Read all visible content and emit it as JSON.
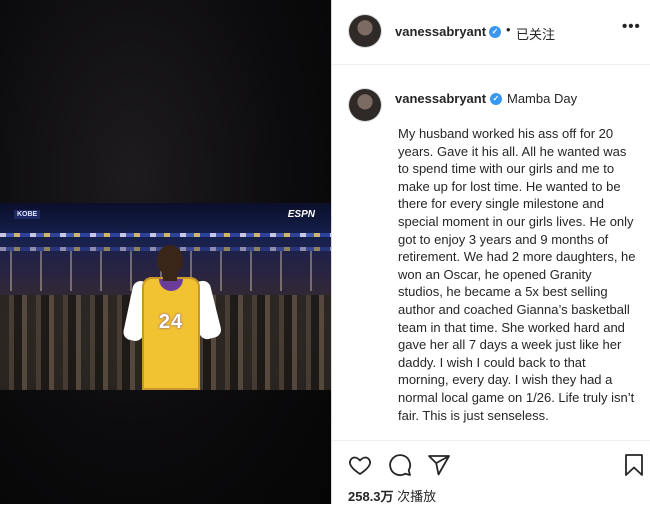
{
  "post": {
    "username": "vanessabryant",
    "verified_icon": "verified-badge-icon",
    "separator": "•",
    "follow_status": "已关注",
    "more_icon": "more-options-icon"
  },
  "video": {
    "overlay_left": "KOBE",
    "overlay_right": "ESPN",
    "jersey_number": "24"
  },
  "caption": {
    "username": "vanessabryant",
    "title": "Mamba Day",
    "body": "My husband worked his ass off for 20 years. Gave it his all. All he wanted was to spend time with our girls and me to make up for lost time. He wanted to be there for every single milestone and special moment in our girls lives. He only got to enjoy 3 years and 9 months of retirement. We had 2 more daughters, he won an Oscar, he opened Granity studios, he became a 5x best selling author and coached Gianna’s basketball team in that time. She worked hard and gave her all 7 days a week just like her daddy. I wish I could back to that morning, every day. I wish they had a normal local game on 1/26. Life truly isn’t fair. This is just senseless."
  },
  "actions": {
    "icons": [
      "heart-icon",
      "comment-icon",
      "share-icon",
      "bookmark-icon"
    ],
    "views_count": "258.3万",
    "views_label": " 次播放"
  },
  "colors": {
    "verified": "#3897f0",
    "text": "#262626",
    "border": "#dbdbdb"
  }
}
